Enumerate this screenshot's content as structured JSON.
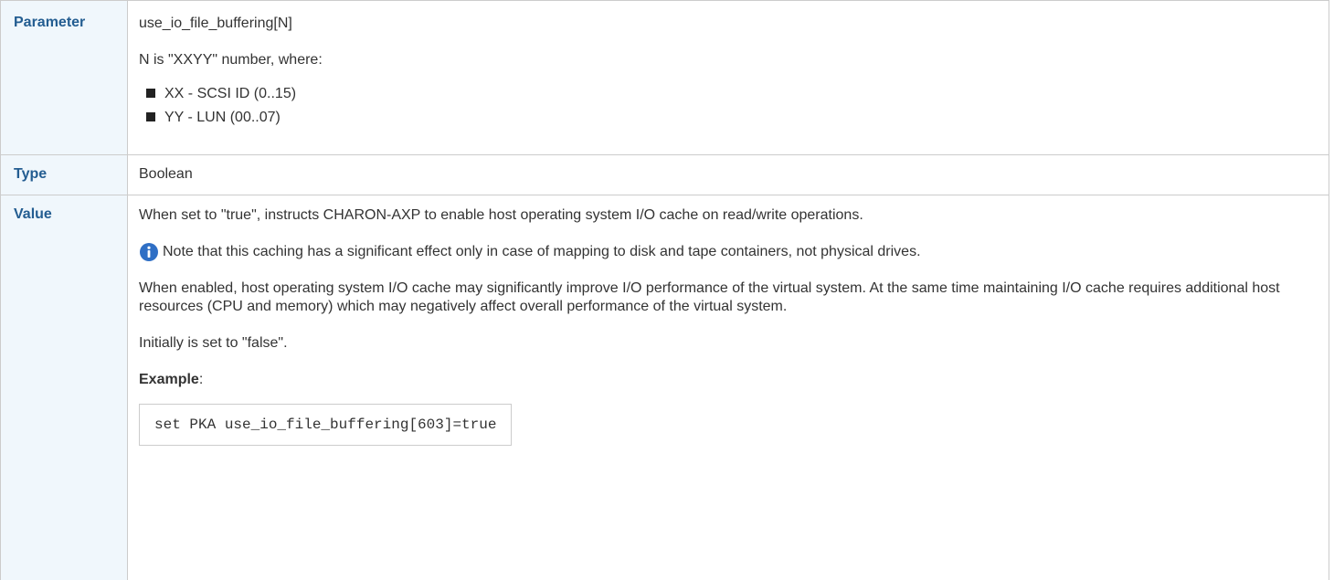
{
  "rows": {
    "parameter": {
      "label": "Parameter",
      "name": "use_io_file_buffering[N]",
      "n_desc": "N is \"XXYY\" number, where:",
      "bullets": [
        "XX - SCSI ID (0..15)",
        "YY - LUN (00..07)"
      ]
    },
    "type": {
      "label": "Type",
      "value": "Boolean"
    },
    "value": {
      "label": "Value",
      "desc": "When set to \"true\", instructs CHARON-AXP to enable host operating system I/O cache on read/write operations.",
      "note": "Note that this caching has a significant effect only in case of mapping to disk and tape containers, not physical drives.",
      "enabled_desc": "When enabled, host operating system I/O cache may significantly improve I/O performance of the virtual system. At the same time maintaining I/O cache requires additional host resources (CPU and memory) which may negatively affect overall performance of the virtual system.",
      "initial": "Initially is set to \"false\".",
      "example_label": "Example",
      "example_colon": ":",
      "code": "set PKA use_io_file_buffering[603]=true"
    }
  },
  "icons": {
    "info": "info-icon",
    "bullet": "square-bullet-icon"
  },
  "colors": {
    "header_bg": "#f0f7fc",
    "header_text": "#235d91",
    "info_icon": "#2f6fc5"
  }
}
